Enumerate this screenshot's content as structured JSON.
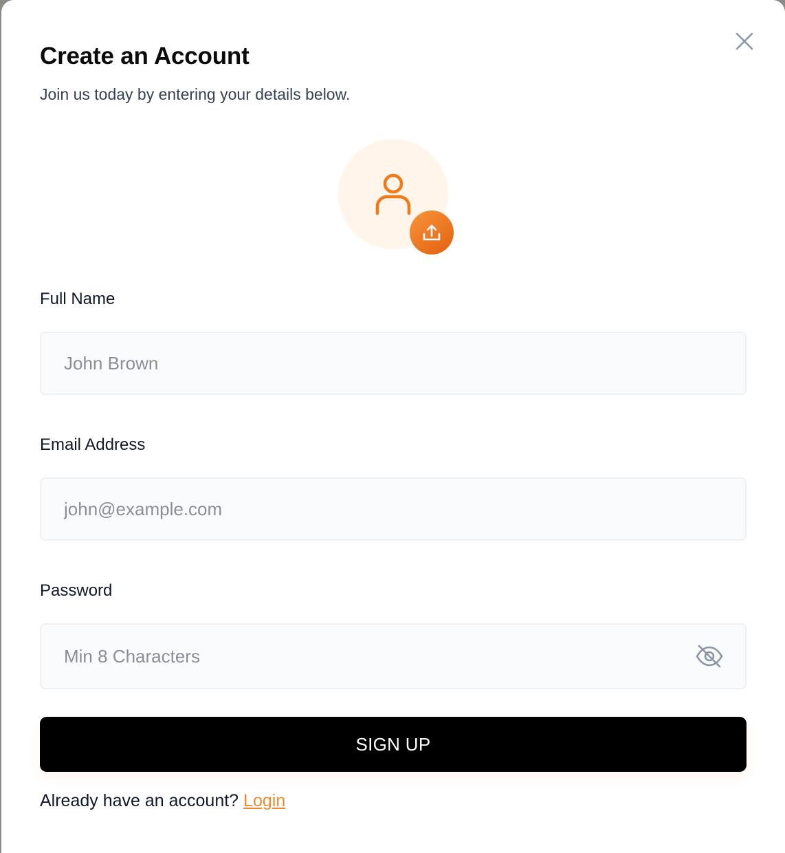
{
  "modal": {
    "title": "Create an Account",
    "subtitle": "Join us today by entering your details below."
  },
  "avatar": {
    "icon": "user-icon",
    "upload_icon": "upload-icon"
  },
  "form": {
    "full_name": {
      "label": "Full Name",
      "placeholder": "John Brown",
      "value": ""
    },
    "email": {
      "label": "Email Address",
      "placeholder": "john@example.com",
      "value": ""
    },
    "password": {
      "label": "Password",
      "placeholder": "Min 8 Characters",
      "value": "",
      "toggle_icon": "eye-off-icon"
    },
    "submit_label": "SIGN UP"
  },
  "footer": {
    "prompt": "Already have an account?",
    "link_label": "Login"
  },
  "colors": {
    "accent": "#ef8a2c",
    "button_bg": "#000000",
    "avatar_bg": "#fff5ea"
  }
}
